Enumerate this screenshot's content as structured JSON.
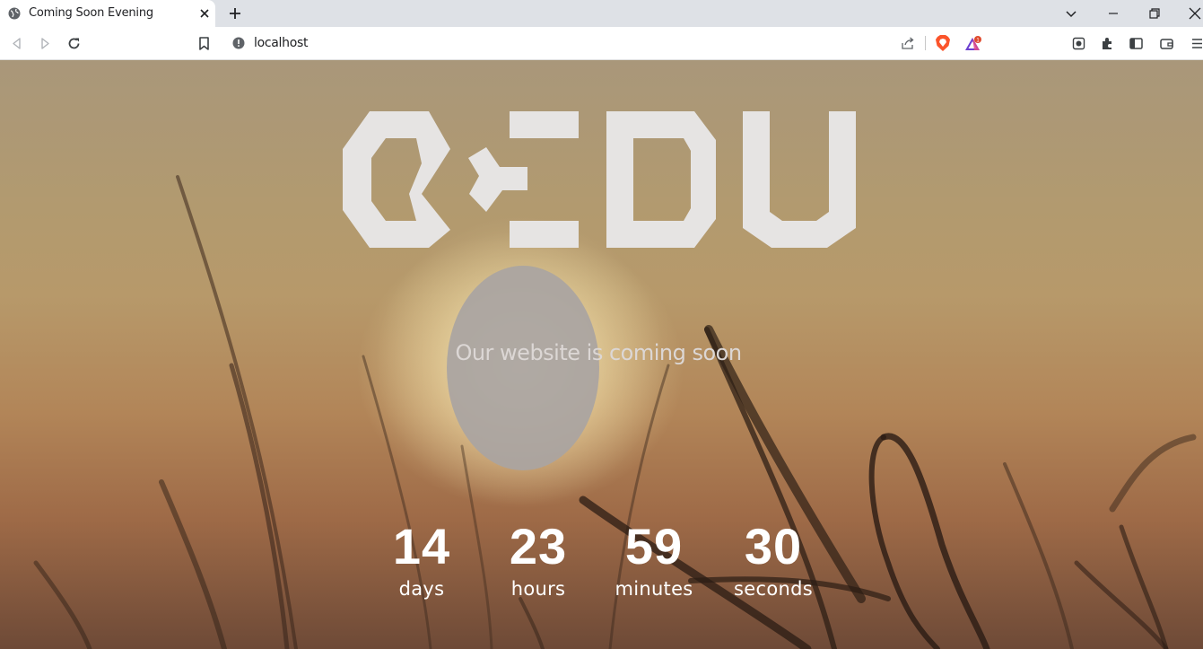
{
  "browser": {
    "tab": {
      "title": "Coming Soon Evening",
      "favicon": "globe-icon"
    },
    "address": {
      "url": "localhost"
    },
    "rewards_badge": "1"
  },
  "page": {
    "logo_text": "BEDU",
    "tagline": "Our website is coming soon",
    "countdown": [
      {
        "value": "14",
        "label": "days"
      },
      {
        "value": "23",
        "label": "hours"
      },
      {
        "value": "59",
        "label": "minutes"
      },
      {
        "value": "30",
        "label": "seconds"
      }
    ]
  },
  "colors": {
    "logo": "#e6e4e3",
    "tagline": "#dcd7d5",
    "brave_orange": "#fb542b",
    "rewards_badge": "#e04a2e"
  }
}
